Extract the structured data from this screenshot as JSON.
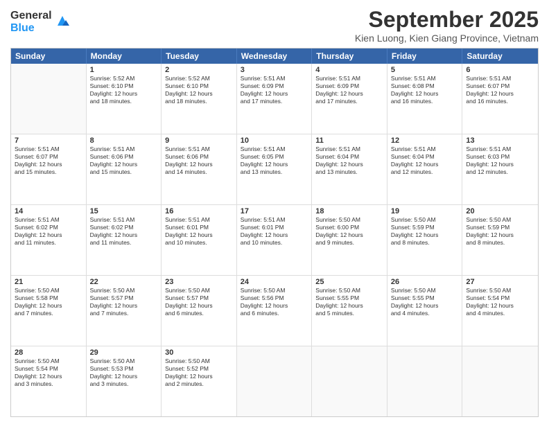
{
  "logo": {
    "general": "General",
    "blue": "Blue"
  },
  "title": "September 2025",
  "subtitle": "Kien Luong, Kien Giang Province, Vietnam",
  "header_days": [
    "Sunday",
    "Monday",
    "Tuesday",
    "Wednesday",
    "Thursday",
    "Friday",
    "Saturday"
  ],
  "weeks": [
    [
      {
        "day": "",
        "text": ""
      },
      {
        "day": "1",
        "text": "Sunrise: 5:52 AM\nSunset: 6:10 PM\nDaylight: 12 hours\nand 18 minutes."
      },
      {
        "day": "2",
        "text": "Sunrise: 5:52 AM\nSunset: 6:10 PM\nDaylight: 12 hours\nand 18 minutes."
      },
      {
        "day": "3",
        "text": "Sunrise: 5:51 AM\nSunset: 6:09 PM\nDaylight: 12 hours\nand 17 minutes."
      },
      {
        "day": "4",
        "text": "Sunrise: 5:51 AM\nSunset: 6:09 PM\nDaylight: 12 hours\nand 17 minutes."
      },
      {
        "day": "5",
        "text": "Sunrise: 5:51 AM\nSunset: 6:08 PM\nDaylight: 12 hours\nand 16 minutes."
      },
      {
        "day": "6",
        "text": "Sunrise: 5:51 AM\nSunset: 6:07 PM\nDaylight: 12 hours\nand 16 minutes."
      }
    ],
    [
      {
        "day": "7",
        "text": "Sunrise: 5:51 AM\nSunset: 6:07 PM\nDaylight: 12 hours\nand 15 minutes."
      },
      {
        "day": "8",
        "text": "Sunrise: 5:51 AM\nSunset: 6:06 PM\nDaylight: 12 hours\nand 15 minutes."
      },
      {
        "day": "9",
        "text": "Sunrise: 5:51 AM\nSunset: 6:06 PM\nDaylight: 12 hours\nand 14 minutes."
      },
      {
        "day": "10",
        "text": "Sunrise: 5:51 AM\nSunset: 6:05 PM\nDaylight: 12 hours\nand 13 minutes."
      },
      {
        "day": "11",
        "text": "Sunrise: 5:51 AM\nSunset: 6:04 PM\nDaylight: 12 hours\nand 13 minutes."
      },
      {
        "day": "12",
        "text": "Sunrise: 5:51 AM\nSunset: 6:04 PM\nDaylight: 12 hours\nand 12 minutes."
      },
      {
        "day": "13",
        "text": "Sunrise: 5:51 AM\nSunset: 6:03 PM\nDaylight: 12 hours\nand 12 minutes."
      }
    ],
    [
      {
        "day": "14",
        "text": "Sunrise: 5:51 AM\nSunset: 6:02 PM\nDaylight: 12 hours\nand 11 minutes."
      },
      {
        "day": "15",
        "text": "Sunrise: 5:51 AM\nSunset: 6:02 PM\nDaylight: 12 hours\nand 11 minutes."
      },
      {
        "day": "16",
        "text": "Sunrise: 5:51 AM\nSunset: 6:01 PM\nDaylight: 12 hours\nand 10 minutes."
      },
      {
        "day": "17",
        "text": "Sunrise: 5:51 AM\nSunset: 6:01 PM\nDaylight: 12 hours\nand 10 minutes."
      },
      {
        "day": "18",
        "text": "Sunrise: 5:50 AM\nSunset: 6:00 PM\nDaylight: 12 hours\nand 9 minutes."
      },
      {
        "day": "19",
        "text": "Sunrise: 5:50 AM\nSunset: 5:59 PM\nDaylight: 12 hours\nand 8 minutes."
      },
      {
        "day": "20",
        "text": "Sunrise: 5:50 AM\nSunset: 5:59 PM\nDaylight: 12 hours\nand 8 minutes."
      }
    ],
    [
      {
        "day": "21",
        "text": "Sunrise: 5:50 AM\nSunset: 5:58 PM\nDaylight: 12 hours\nand 7 minutes."
      },
      {
        "day": "22",
        "text": "Sunrise: 5:50 AM\nSunset: 5:57 PM\nDaylight: 12 hours\nand 7 minutes."
      },
      {
        "day": "23",
        "text": "Sunrise: 5:50 AM\nSunset: 5:57 PM\nDaylight: 12 hours\nand 6 minutes."
      },
      {
        "day": "24",
        "text": "Sunrise: 5:50 AM\nSunset: 5:56 PM\nDaylight: 12 hours\nand 6 minutes."
      },
      {
        "day": "25",
        "text": "Sunrise: 5:50 AM\nSunset: 5:55 PM\nDaylight: 12 hours\nand 5 minutes."
      },
      {
        "day": "26",
        "text": "Sunrise: 5:50 AM\nSunset: 5:55 PM\nDaylight: 12 hours\nand 4 minutes."
      },
      {
        "day": "27",
        "text": "Sunrise: 5:50 AM\nSunset: 5:54 PM\nDaylight: 12 hours\nand 4 minutes."
      }
    ],
    [
      {
        "day": "28",
        "text": "Sunrise: 5:50 AM\nSunset: 5:54 PM\nDaylight: 12 hours\nand 3 minutes."
      },
      {
        "day": "29",
        "text": "Sunrise: 5:50 AM\nSunset: 5:53 PM\nDaylight: 12 hours\nand 3 minutes."
      },
      {
        "day": "30",
        "text": "Sunrise: 5:50 AM\nSunset: 5:52 PM\nDaylight: 12 hours\nand 2 minutes."
      },
      {
        "day": "",
        "text": ""
      },
      {
        "day": "",
        "text": ""
      },
      {
        "day": "",
        "text": ""
      },
      {
        "day": "",
        "text": ""
      }
    ]
  ]
}
